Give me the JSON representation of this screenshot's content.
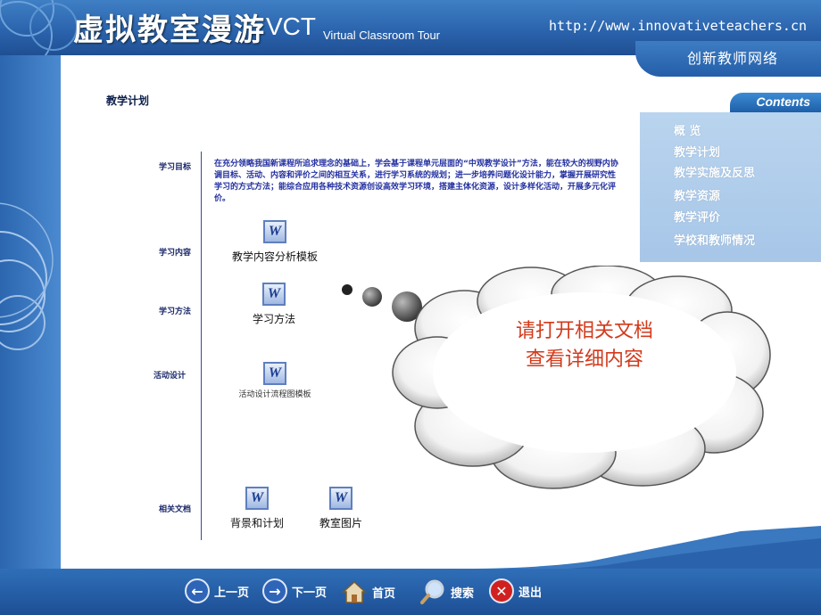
{
  "header": {
    "title_cn": "虚拟教室漫游",
    "title_vct": "VCT",
    "title_en": "Virtual Classroom Tour",
    "url": "http://www.innovativeteachers.cn",
    "network": "创新教师网络"
  },
  "contents": {
    "tab": "Contents",
    "items": [
      {
        "label": "概  览"
      },
      {
        "label": "教学计划"
      },
      {
        "label": "教学实施及反思"
      },
      {
        "label": "教学资源"
      },
      {
        "label": "教学评价"
      },
      {
        "label": "学校和教师情况"
      }
    ]
  },
  "main": {
    "title": "教学计划",
    "sections": {
      "objective": "学习目标",
      "content": "学习内容",
      "method": "学习方法",
      "activity": "活动设计",
      "related": "相关文档"
    },
    "objective_text": "在充分领略我国新课程所追求理念的基础上，学会基于课程单元层面的“中观教学设计”方法，能在较大的视野内协调目标、活动、内容和评价之间的相互关系，进行学习系统的规划；进一步培养问题化设计能力，掌握开展研究性学习的方式方法；能综合应用各种技术资源创设高效学习环境，搭建主体化资源，设计多样化活动，开展多元化评价。",
    "docs": {
      "content_doc": "教学内容分析模板",
      "method_doc": "学习方法",
      "activity_doc": "活动设计流程图模板",
      "related_doc1": "背景和计划",
      "related_doc2": "教室图片"
    },
    "doc_icon": "W"
  },
  "cloud": {
    "line1": "请打开相关文档",
    "line2": "查看详细内容"
  },
  "footer": {
    "prev": "上一页",
    "next": "下一页",
    "home": "首页",
    "search": "搜索",
    "exit": "退出"
  }
}
